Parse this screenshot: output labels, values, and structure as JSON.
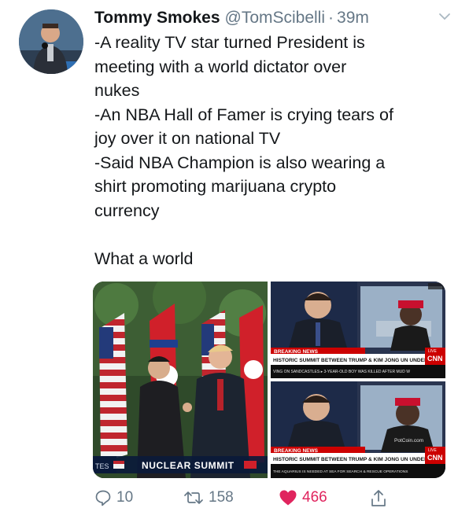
{
  "tweet": {
    "display_name": "Tommy Smokes",
    "handle": "@TomScibelli",
    "separator": "·",
    "time": "39m",
    "text_lines": [
      "-A reality TV star turned President is",
      "meeting with a world dictator over",
      "nukes",
      "-An NBA Hall of Famer is crying tears of",
      "joy over it on national TV",
      "-Said NBA Champion is also wearing a",
      "shirt promoting marijuana crypto",
      "currency"
    ],
    "closing_line": "What a world"
  },
  "media": {
    "left_banner": "NUCLEAR SUMMIT",
    "left_banner_prefix": "TES",
    "cnn_top": {
      "breaking": "BREAKING NEWS",
      "headline": "HISTORIC SUMMIT BETWEEN TRUMP & KIM JONG UN UNDERWAY",
      "ticker": "VING ON SANDCASTLES  ▸ 3-YEAR-OLD BOY WAS KILLED AFTER MUD W",
      "logo": "CNN",
      "live": "LIVE"
    },
    "cnn_bottom": {
      "breaking": "BREAKING NEWS",
      "headline": "HISTORIC SUMMIT BETWEEN TRUMP & KIM JONG UN UNDERWAY",
      "ticker": "THE AQUARIUS IS NEEDED AT SEA FOR SEARCH & RESCUE OPERATIONS",
      "logo": "CNN",
      "live": "LIVE",
      "shirt_text": "PotCoin.com"
    }
  },
  "actions": {
    "reply_count": "10",
    "retweet_count": "158",
    "like_count": "466"
  },
  "colors": {
    "like": "#e0245e",
    "muted": "#657786",
    "cnn_red": "#cc0000"
  }
}
